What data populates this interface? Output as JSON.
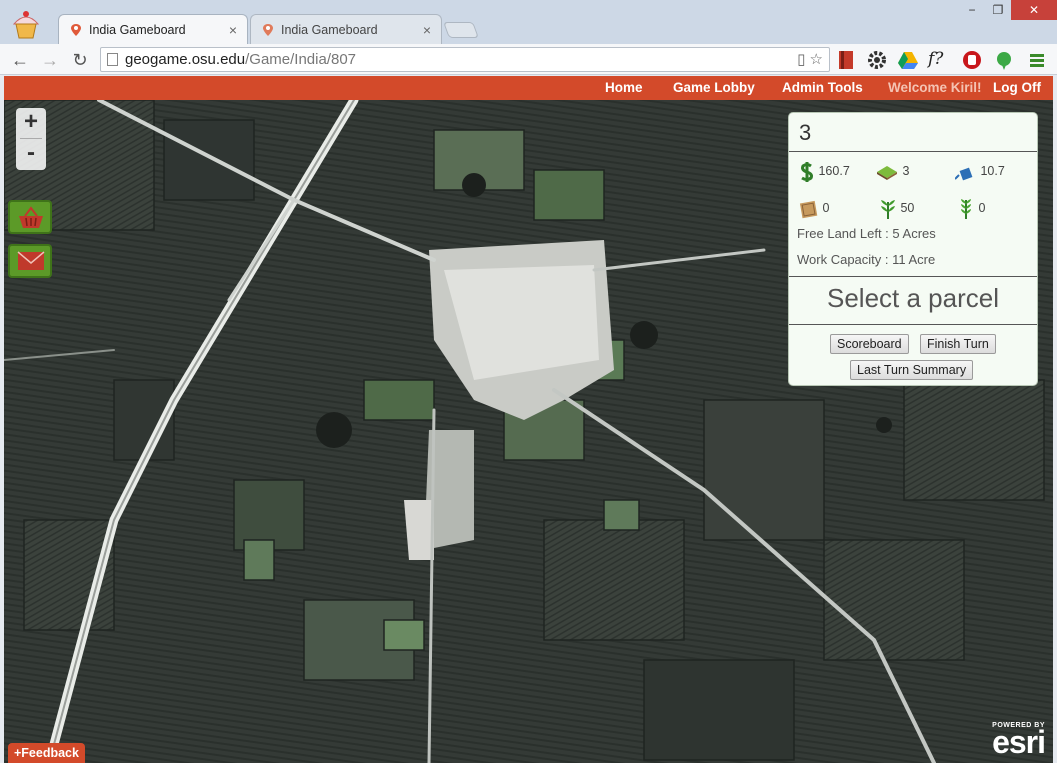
{
  "browser": {
    "tabs": [
      {
        "label": "India Gameboard",
        "active": true
      },
      {
        "label": "India Gameboard",
        "active": false
      }
    ],
    "url": {
      "host": "geogame.osu.edu",
      "path": "/Game/India/807"
    },
    "window_controls": {
      "minimize": "−",
      "restore": "❐",
      "close": "✕"
    }
  },
  "site_nav": {
    "home": "Home",
    "game_lobby": "Game Lobby",
    "admin_tools": "Admin Tools",
    "welcome": "Welcome Kiril!",
    "log_off": "Log Off"
  },
  "map": {
    "zoom_in": "+",
    "zoom_out": "-",
    "feedback": "+Feedback",
    "esri_powered": "POWERED BY",
    "esri_brand": "esri"
  },
  "panel": {
    "turn": "3",
    "resources": {
      "money": "160.7",
      "land": "3",
      "water": "10.7",
      "seed": "0",
      "crop_a": "50",
      "crop_b": "0"
    },
    "free_land": "Free Land Left : 5 Acres",
    "work_capacity": "Work Capacity : 11 Acre",
    "select_label": "Select a parcel",
    "scoreboard_button": "Scoreboard",
    "finish_turn_button": "Finish Turn",
    "last_turn_button": "Last Turn Summary"
  },
  "colors": {
    "nav_bar": "#d34a2a",
    "side_button": "#5c9a28",
    "panel_bg": "#f5fbf4",
    "money_icon": "#2f7d28"
  }
}
